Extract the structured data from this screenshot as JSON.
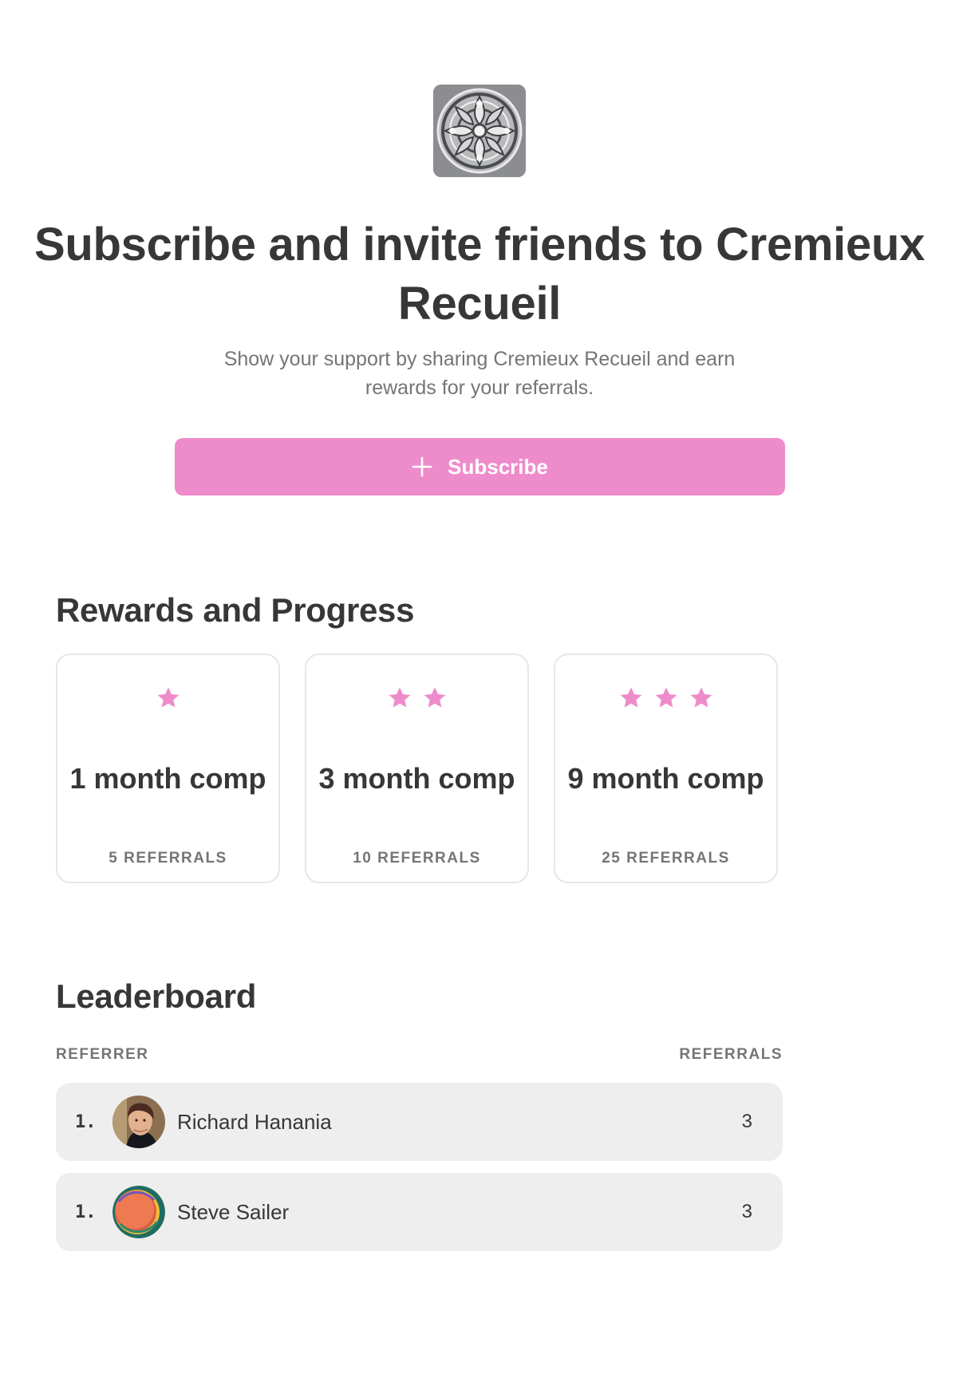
{
  "publication": {
    "logo_icon": "ornamental-medallion-icon",
    "title": "Subscribe and invite friends to Cremieux Recueil",
    "subtitle": "Show your support by sharing Cremieux Recueil and earn rewards for your referrals.",
    "subscribe_label": "Subscribe",
    "subscribe_icon": "plus-icon",
    "accent_color": "#ee8ccb"
  },
  "rewards": {
    "title": "Rewards and Progress",
    "tiers": [
      {
        "stars": 1,
        "name": "1 month comp",
        "requirement": "5 REFERRALS"
      },
      {
        "stars": 2,
        "name": "3 month comp",
        "requirement": "10 REFERRALS"
      },
      {
        "stars": 3,
        "name": "9 month comp",
        "requirement": "25 REFERRALS"
      }
    ]
  },
  "leaderboard": {
    "title": "Leaderboard",
    "columns": {
      "referrer": "REFERRER",
      "referrals": "REFERRALS"
    },
    "rows": [
      {
        "rank": "1.",
        "name": "Richard Hanania",
        "referrals": "3",
        "avatar_icon": "person-avatar-icon"
      },
      {
        "rank": "1.",
        "name": "Steve Sailer",
        "referrals": "3",
        "avatar_icon": "colorful-circle-avatar-icon"
      }
    ]
  }
}
